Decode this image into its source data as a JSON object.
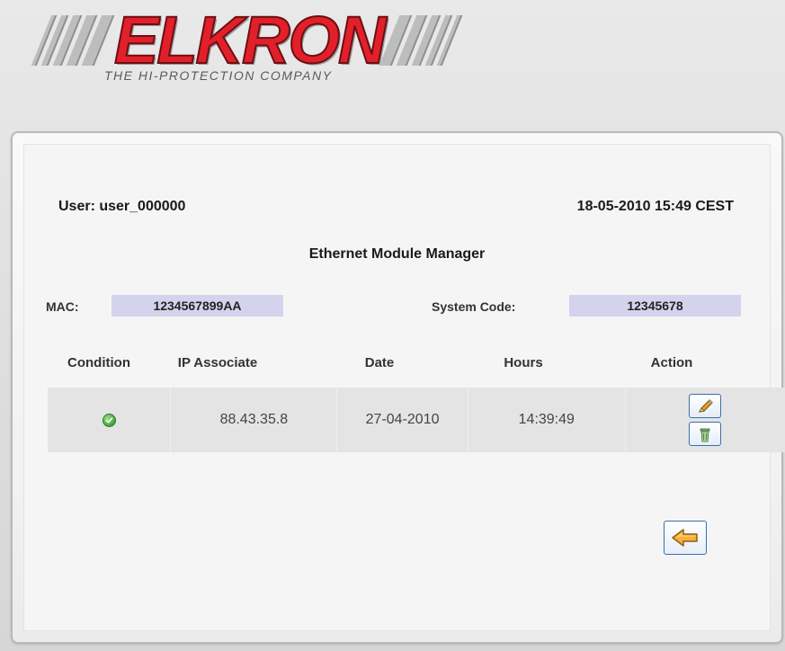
{
  "brand": {
    "name": "ELKRON",
    "tagline": "THE HI-PROTECTION COMPANY",
    "color": "#e2202a"
  },
  "header": {
    "user_label": "User: user_000000",
    "datetime": "18-05-2010 15:49 CEST"
  },
  "page_title": "Ethernet Module Manager",
  "mac": {
    "label": "MAC:",
    "value": "1234567899AA"
  },
  "system_code": {
    "label": "System Code:",
    "value": "12345678"
  },
  "table": {
    "columns": [
      "Condition",
      "IP Associate",
      "Date",
      "Hours",
      "Action"
    ],
    "rows": [
      {
        "condition": "ok",
        "ip": "88.43.35.8",
        "date": "27-04-2010",
        "hours": "14:39:49"
      }
    ]
  },
  "icons": {
    "condition_ok": "check-circle-icon",
    "edit": "pencil-icon",
    "delete": "trash-icon",
    "back": "arrow-left-icon"
  }
}
